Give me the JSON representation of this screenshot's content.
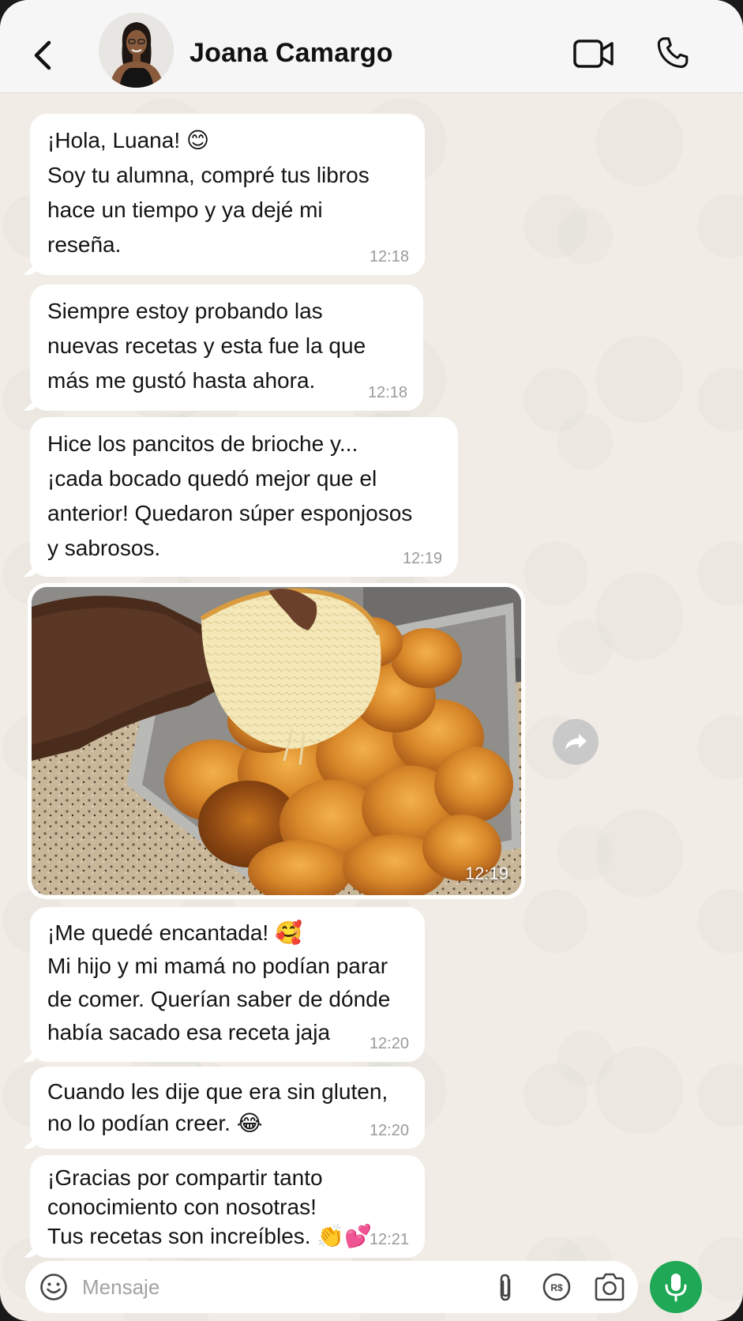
{
  "header": {
    "contact_name": "Joana Camargo"
  },
  "messages": [
    {
      "lines": [
        "¡Hola, Luana! 😊",
        "Soy tu alumna, compré tus libros",
        "hace un tiempo y ya dejé mi",
        "reseña."
      ],
      "time": "12:18"
    },
    {
      "lines": [
        "Siempre estoy probando las",
        "nuevas recetas y esta fue la que",
        "más me gustó hasta ahora."
      ],
      "time": "12:18"
    },
    {
      "lines": [
        "Hice los pancitos de brioche y...",
        "¡cada bocado quedó mejor que el",
        "anterior! Quedaron súper esponjosos",
        "y sabrosos."
      ],
      "time": "12:19"
    },
    {
      "lines": [
        "¡Me quedé encantada! 🥰",
        "Mi hijo y mi mamá no podían parar",
        "de comer. Querían saber de dónde",
        "había sacado esa receta jaja"
      ],
      "time": "12:20"
    },
    {
      "lines": [
        "Cuando les dije que era sin gluten,",
        "no lo podían creer. 😂"
      ],
      "time": "12:20"
    },
    {
      "lines": [
        "¡Gracias por compartir tanto",
        "conocimiento con nosotras!",
        "Tus recetas son increíbles. 👏💕"
      ],
      "time": "12:21"
    }
  ],
  "photo_message": {
    "time": "12:19"
  },
  "input": {
    "placeholder": "Mensaje"
  },
  "colors": {
    "chat_background": "#f1ede6",
    "bubble": "#ffffff",
    "mic_button": "#1fa855",
    "header": "#f6f6f6"
  },
  "icons": [
    "back-arrow-icon",
    "video-call-icon",
    "phone-icon",
    "forward-icon",
    "emoji-icon",
    "attach-icon",
    "payment-icon",
    "camera-icon",
    "microphone-icon"
  ]
}
